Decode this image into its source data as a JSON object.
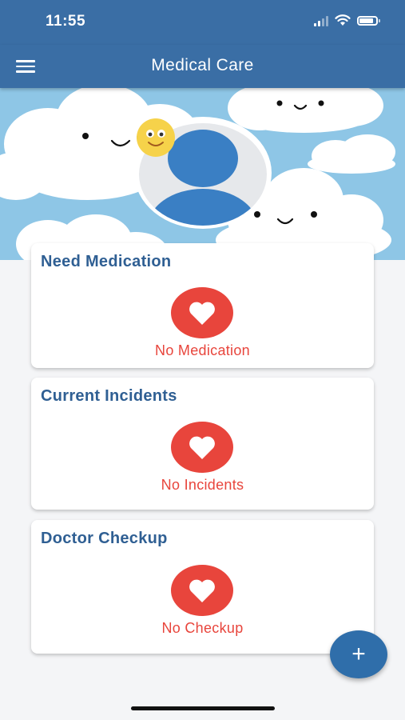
{
  "status_bar": {
    "time": "11:55",
    "icons": [
      "signal-icon",
      "wifi-icon",
      "battery-icon"
    ]
  },
  "app_bar": {
    "title": "Medical Care",
    "menu_icon": "hamburger-menu-icon"
  },
  "banner": {
    "illustration": "smiling-clouds",
    "avatar_icon": "user-avatar-icon"
  },
  "cards": [
    {
      "title": "Need Medication",
      "status": "No Medication",
      "icon": "heart-icon"
    },
    {
      "title": "Current Incidents",
      "status": "No Incidents",
      "icon": "heart-icon"
    },
    {
      "title": "Doctor Checkup",
      "status": "No Checkup",
      "icon": "heart-icon"
    }
  ],
  "fab": {
    "label": "+",
    "icon": "plus-icon"
  },
  "colors": {
    "primary": "#3a6ea5",
    "accent": "#e8453c",
    "title_text": "#2f5f93",
    "sky": "#8ec6e6"
  }
}
